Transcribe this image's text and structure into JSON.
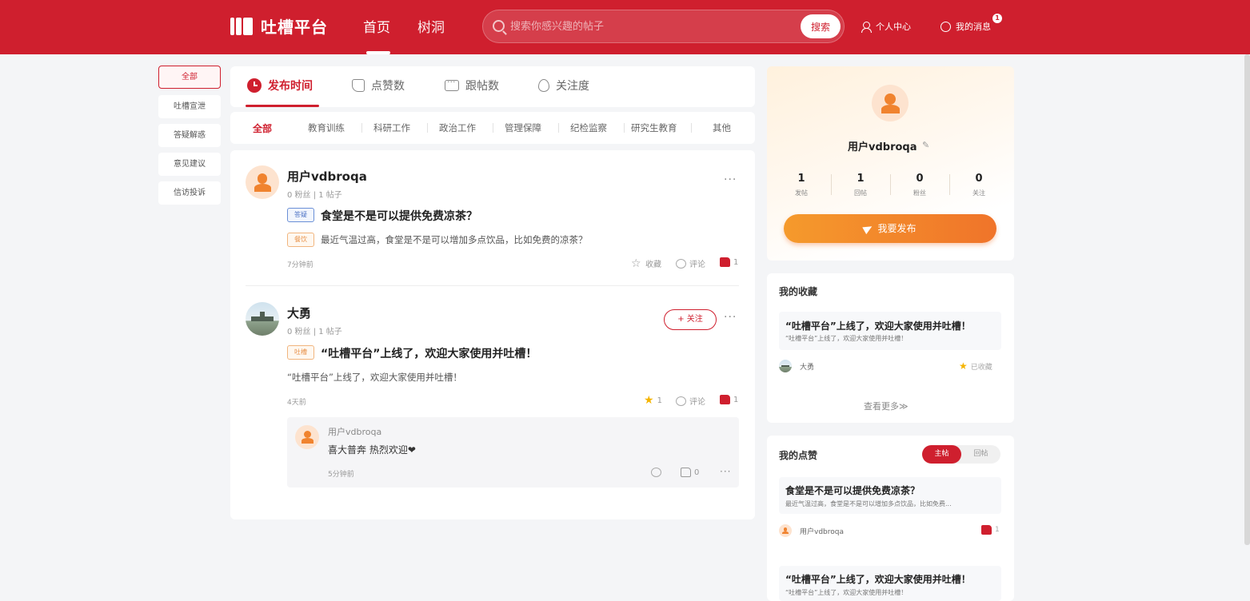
{
  "header": {
    "logo_text": "吐槽平台",
    "nav": [
      "首页",
      "树洞"
    ],
    "search_placeholder": "搜索你感兴趣的帖子",
    "search_button": "搜索",
    "personal_center": "个人中心",
    "my_messages": "我的消息",
    "message_badge": "1"
  },
  "sidebar": {
    "categories": [
      "全部",
      "吐槽宣泄",
      "答疑解惑",
      "意见建议",
      "信访投诉"
    ]
  },
  "sort_tabs": [
    "发布时间",
    "点赞数",
    "跟帖数",
    "关注度"
  ],
  "filters": [
    "全部",
    "教育训练",
    "科研工作",
    "政治工作",
    "管理保障",
    "纪检监察",
    "研究生教育",
    "其他"
  ],
  "posts": [
    {
      "author": "用户vdbroqa",
      "meta": "0 粉丝 | 1 帖子",
      "tag1": "答疑",
      "title": "食堂是不是可以提供免费凉茶？",
      "tag2": "餐饮",
      "body": "最近气温过高，食堂是不是可以增加多点饮品，比如免费的凉茶？",
      "time": "7分钟前",
      "fav_label": "收藏",
      "comment_label": "评论",
      "likes": "1"
    },
    {
      "author": "大勇",
      "meta": "0 粉丝 | 1 帖子",
      "follow_label": "+ 关注",
      "tag1": "吐槽",
      "title": "“吐槽平台”上线了，欢迎大家使用并吐槽！",
      "body": "“吐槽平台”上线了，欢迎大家使用并吐槽！",
      "time": "4天前",
      "fav_count": "1",
      "comment_label": "评论",
      "likes": "1",
      "reply": {
        "author": "用户vdbroqa",
        "text": "喜大普奔 热烈欢迎❤",
        "time": "5分钟前",
        "likes": "0"
      }
    }
  ],
  "profile": {
    "name": "用户vdbroqa",
    "stats": [
      {
        "value": "1",
        "label": "发帖"
      },
      {
        "value": "1",
        "label": "回帖"
      },
      {
        "value": "0",
        "label": "粉丝"
      },
      {
        "value": "0",
        "label": "关注"
      }
    ],
    "publish_button": "我要发布"
  },
  "favorites": {
    "title": "我的收藏",
    "item_title": "“吐槽平台”上线了，欢迎大家使用并吐槽！",
    "item_sub": "“吐槽平台”上线了，欢迎大家使用并吐槽！",
    "author": "大勇",
    "state": "已收藏",
    "see_more": "查看更多≫"
  },
  "likes_section": {
    "title": "我的点赞",
    "toggle_on": "主帖",
    "toggle_off": "回帖",
    "item1_title": "食堂是不是可以提供免费凉茶？",
    "item1_sub": "最近气温过高，食堂是不是可以增加多点饮品，比如免费...",
    "item1_author": "用户vdbroqa",
    "item1_likes": "1",
    "item2_title": "“吐槽平台”上线了，欢迎大家使用并吐槽！",
    "item2_sub": "“吐槽平台”上线了，欢迎大家使用并吐槽！"
  },
  "colors": {
    "primary": "#cf1f2e",
    "accent_orange": "#f0832f"
  }
}
